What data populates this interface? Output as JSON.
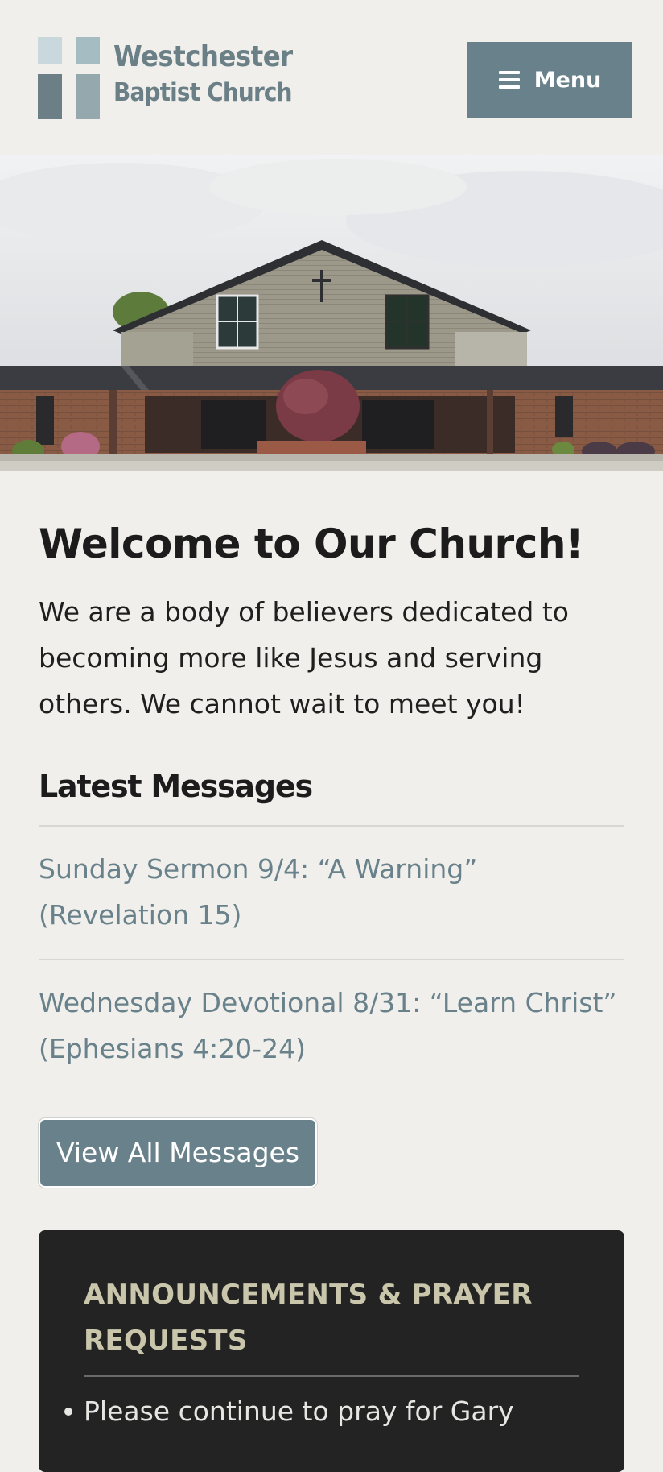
{
  "header": {
    "logo_line1": "Westchester",
    "logo_line2": "Baptist Church",
    "menu_label": "Menu"
  },
  "hero": {
    "alt": "Church building photo"
  },
  "welcome": {
    "title": "Welcome to Our Church!",
    "text": "We are a body of believers dedicated to becoming more like Jesus and serving others. We cannot wait to meet you!"
  },
  "messages": {
    "title": "Latest Messages",
    "items": [
      {
        "line1": "Sunday Sermon 9/4: “A Warning”",
        "line2": "(Revelation 15)"
      },
      {
        "line1": "Wednesday Devotional 8/31: “Learn Christ”",
        "line2": "(Ephesians 4:20-24)"
      }
    ],
    "view_all_label": "View All Messages"
  },
  "announcements": {
    "title_line1": "ANNOUNCEMENTS & PRAYER",
    "title_line2": "REQUESTS",
    "items": [
      "Please continue to pray for Gary"
    ]
  },
  "colors": {
    "accent": "#68818a",
    "background": "#f0efeb",
    "panel": "#232323",
    "panel_heading": "#c9c6ac"
  }
}
